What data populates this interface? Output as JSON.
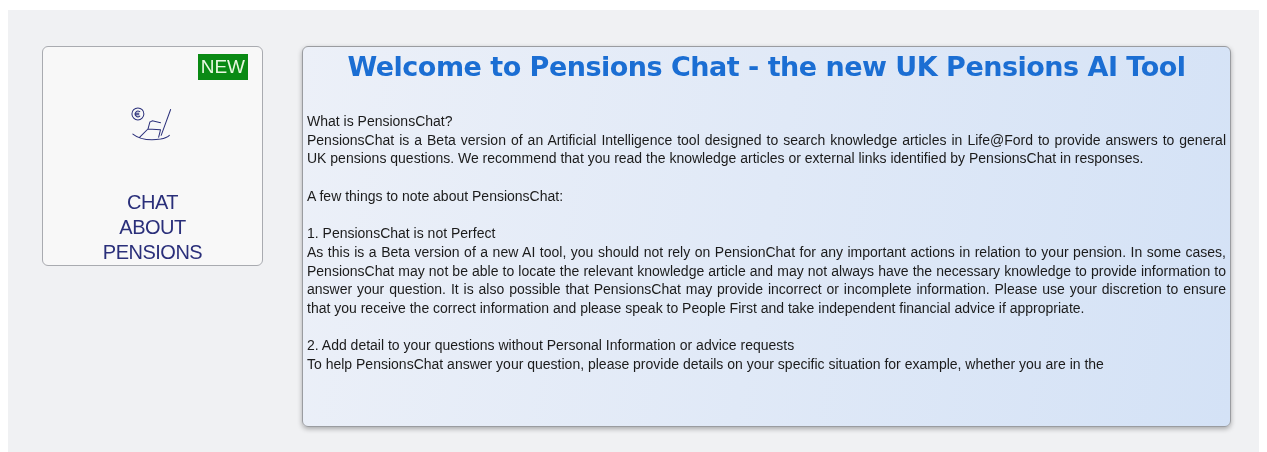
{
  "tile": {
    "badge": "NEW",
    "label": "CHAT ABOUT PENSIONS"
  },
  "panel": {
    "title": "Welcome to Pensions Chat - the new UK Pensions AI Tool",
    "blocks": [
      {
        "lines": [
          "What is PensionsChat?",
          "PensionsChat is a Beta version of an Artificial Intelligence tool designed to search knowledge articles in Life@Ford to provide answers to general UK pensions questions. We recommend that you read the knowledge articles or external links identified by PensionsChat in responses."
        ]
      },
      {
        "lines": [
          "A few things to note about PensionsChat:"
        ]
      },
      {
        "lines": [
          "1. PensionsChat is not Perfect",
          "As this is a Beta version of a new AI tool, you should not rely on PensionChat for any important actions in relation to your pension. In some cases, PensionsChat may not be able to locate the relevant knowledge article and may not always have the necessary knowledge to provide information to answer your question. It is also possible that PensionsChat may provide incorrect or incomplete information. Please use your discretion to ensure that you receive the correct information and please speak to People First and take independent financial advice if appropriate."
        ]
      },
      {
        "lines": [
          "2. Add detail to your questions without Personal Information or advice requests",
          "To help PensionsChat answer your question, please provide details on your specific situation for example, whether you are in the"
        ]
      }
    ]
  }
}
